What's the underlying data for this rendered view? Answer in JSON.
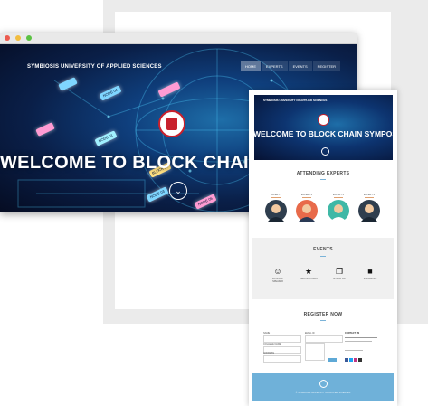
{
  "browser": {
    "window_dots": [
      {
        "name": "close",
        "color": "#ec5b4f"
      },
      {
        "name": "minimize",
        "color": "#f2bd40"
      },
      {
        "name": "maximize",
        "color": "#5bc243"
      }
    ]
  },
  "hero": {
    "site_title": "SYMBIOSIS UNIVERSITY OF APPLIED SCIENCES",
    "nav": [
      "HOME",
      "EXPERTS",
      "EVENTS",
      "REGISTER"
    ],
    "active_nav": "HOME",
    "headline": "WELCOME TO BLOCK CHAIN",
    "nodes": [
      "NODE 04",
      "NODE 01",
      "BLOCK 01",
      "NODE 03",
      "NODE 05"
    ],
    "scroll_icon": "chevron-down-icon"
  },
  "preview": {
    "site_title": "SYMBIOSIS UNIVERSITY OF APPLIED SCIENCES",
    "headline": "WELCOME TO BLOCK CHAIN SYMPOSIUM",
    "experts_title": "ATTENDING EXPERTS",
    "expert_labels": [
      "EXPERT 1",
      "EXPERT 2",
      "EXPERT 3",
      "EXPERT 4"
    ],
    "events_title": "EVENTS",
    "events": [
      {
        "icon": "smiley-icon",
        "label": "KEYNOTE SPEAKER"
      },
      {
        "icon": "star-icon",
        "label": "SPECIAL EVENT"
      },
      {
        "icon": "copy-icon",
        "label": "HANDS ON"
      },
      {
        "icon": "alert-icon",
        "label": "IMPORTANT"
      }
    ],
    "register_title": "REGISTER NOW",
    "form_labels": [
      "NAME",
      "EMAIL ID",
      "COLLEGE NAME",
      "ADDRESS"
    ],
    "contact_title": "CONTACT US",
    "footer_text": "© SYMBIOSIS UNIVERSITY OF APPLIED SCIENCES"
  },
  "colors": {
    "accent": "#6fb1d9",
    "brand_red": "#c8202c"
  }
}
